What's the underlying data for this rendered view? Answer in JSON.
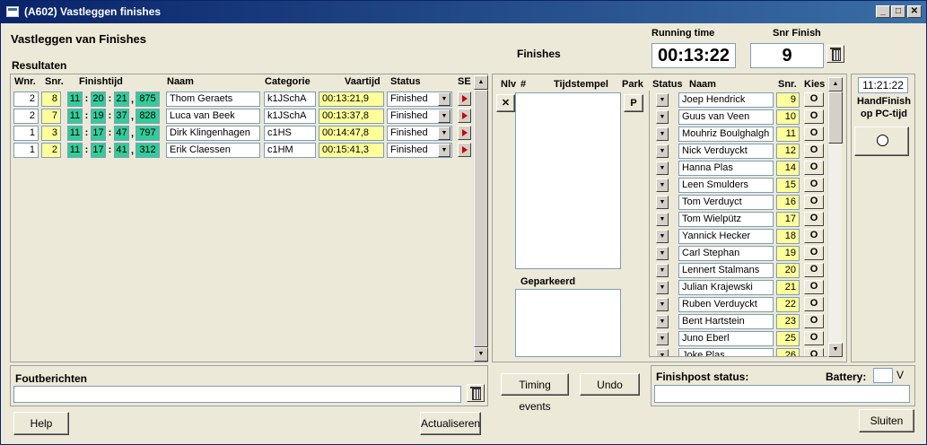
{
  "window": {
    "title": "(A602) Vastleggen finishes"
  },
  "header": {
    "form_title": "Vastleggen van Finishes",
    "results_title": "Resultaten",
    "finishes_title": "Finishes",
    "running_time_label": "Running time",
    "running_time": "00:13:22",
    "snr_finish_label": "Snr Finish",
    "snr_finish": "9"
  },
  "results": {
    "columns": {
      "wnr": "Wnr.",
      "snr": "Snr.",
      "finishtijd": "Finishtijd",
      "naam": "Naam",
      "categorie": "Categorie",
      "vaartijd": "Vaartijd",
      "status": "Status",
      "se": "SE"
    },
    "rows": [
      {
        "wnr": "2",
        "snr": "8",
        "h": "11",
        "m": "20",
        "s": "21",
        "ms": "875",
        "naam": "Thom Geraets",
        "categorie": "k1JSchA",
        "vaartijd": "00:13:21,9",
        "status": "Finished"
      },
      {
        "wnr": "2",
        "snr": "7",
        "h": "11",
        "m": "19",
        "s": "37",
        "ms": "828",
        "naam": "Luca van Beek",
        "categorie": "k1JSchA",
        "vaartijd": "00:13:37,8",
        "status": "Finished"
      },
      {
        "wnr": "1",
        "snr": "3",
        "h": "11",
        "m": "17",
        "s": "47",
        "ms": "797",
        "naam": "Dirk Klingenhagen",
        "categorie": "c1HS",
        "vaartijd": "00:14:47,8",
        "status": "Finished"
      },
      {
        "wnr": "1",
        "snr": "2",
        "h": "11",
        "m": "17",
        "s": "41",
        "ms": "312",
        "naam": "Erik Claessen",
        "categorie": "c1HM",
        "vaartijd": "00:15:41,3",
        "status": "Finished"
      }
    ]
  },
  "finishes": {
    "columns": {
      "nlv": "Nlv",
      "hash": "#",
      "tijdstempel": "Tijdstempel",
      "park": "Park"
    },
    "nlv_button": "✕",
    "park_button": "P",
    "geparkeerd_label": "Geparkeerd"
  },
  "participants": {
    "columns": {
      "status": "Status",
      "naam": "Naam",
      "snr": "Snr.",
      "kies": "Kies"
    },
    "kies_symbol": "O",
    "rows": [
      {
        "naam": "Joep Hendrick",
        "snr": "9"
      },
      {
        "naam": "Guus van Veen",
        "snr": "10"
      },
      {
        "naam": "Mouhriz Boulghalgh",
        "snr": "11"
      },
      {
        "naam": "Nick Verduyckt",
        "snr": "12"
      },
      {
        "naam": "Hanna Plas",
        "snr": "14"
      },
      {
        "naam": "Leen Smulders",
        "snr": "15"
      },
      {
        "naam": "Tom Verduyct",
        "snr": "16"
      },
      {
        "naam": "Tom Wielpütz",
        "snr": "17"
      },
      {
        "naam": "Yannick Hecker",
        "snr": "18"
      },
      {
        "naam": "Carl Stephan",
        "snr": "19"
      },
      {
        "naam": "Lennert Stalmans",
        "snr": "20"
      },
      {
        "naam": "Julian Krajewski",
        "snr": "21"
      },
      {
        "naam": "Ruben Verduyckt",
        "snr": "22"
      },
      {
        "naam": "Bent Hartstein",
        "snr": "23"
      },
      {
        "naam": "Juno Eberl",
        "snr": "25"
      },
      {
        "naam": "Joke Plas",
        "snr": "26"
      }
    ]
  },
  "handfinish": {
    "clock": "11:21:22",
    "label_line1": "HandFinish",
    "label_line2": "op PC-tijd"
  },
  "footer": {
    "foutberichten_label": "Foutberichten",
    "timing_events_button": "Timing events",
    "undo_button": "Undo",
    "finishpost_status_label": "Finishpost status:",
    "battery_label": "Battery:",
    "battery_unit": "V",
    "help_button": "Help",
    "actualiseren_button": "Actualiseren",
    "sluiten_button": "Sluiten"
  },
  "colors": {
    "title_bar": "#0a246a",
    "snr_highlight": "#ffff99",
    "finishtijd_highlight": "#33cc99",
    "se_arrow": "#cc0000"
  }
}
